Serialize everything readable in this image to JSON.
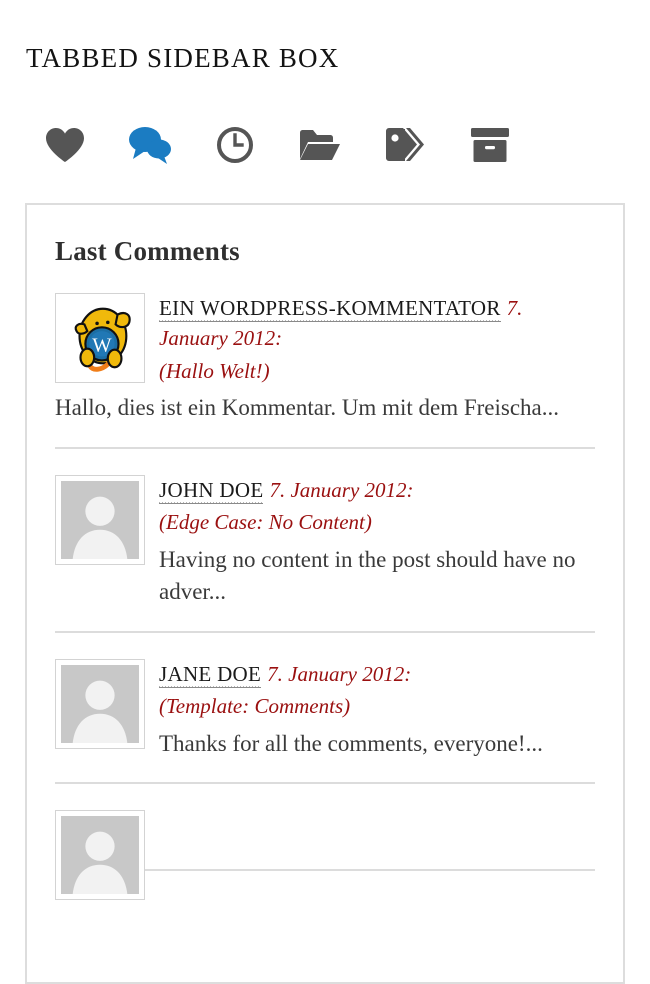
{
  "widget": {
    "title": "TABBED SIDEBAR BOX"
  },
  "colors": {
    "icon_default": "#555555",
    "icon_active": "#1b7cc2",
    "link_red": "#9a1010",
    "panel_border": "#dddddd",
    "divider": "#dcdcdc",
    "heading": "#2f2f2f"
  },
  "tabs": [
    {
      "icon": "heart-icon",
      "label": "Popular",
      "active": false
    },
    {
      "icon": "comments-icon",
      "label": "Last Comments",
      "active": true
    },
    {
      "icon": "clock-icon",
      "label": "Recent",
      "active": false
    },
    {
      "icon": "folder-open-icon",
      "label": "Categories",
      "active": false
    },
    {
      "icon": "tags-icon",
      "label": "Tags",
      "active": false
    },
    {
      "icon": "archive-box-icon",
      "label": "Archives",
      "active": false
    }
  ],
  "panel": {
    "heading": "Last Comments",
    "comments": [
      {
        "avatar": "wapuu-avatar",
        "author": "EIN WORDPRESS-KOMMENTATOR",
        "date": "7. January 2012:",
        "post": "(Hallo Welt!)",
        "excerpt": "Hallo, dies ist ein Kommentar. Um mit dem Freischa..."
      },
      {
        "avatar": "mystery-person-avatar",
        "author": "JOHN DOE",
        "date": "7. January 2012:",
        "post": "(Edge Case: No Content)",
        "excerpt": "Having no content in the post should have no adver..."
      },
      {
        "avatar": "mystery-person-avatar",
        "author": "JANE DOE",
        "date": "7. January 2012:",
        "post": "(Template: Comments)",
        "excerpt": "Thanks for all the comments, everyone!..."
      },
      {
        "avatar": "mystery-person-avatar",
        "author": "",
        "date": "",
        "post": "",
        "excerpt": ""
      }
    ]
  }
}
